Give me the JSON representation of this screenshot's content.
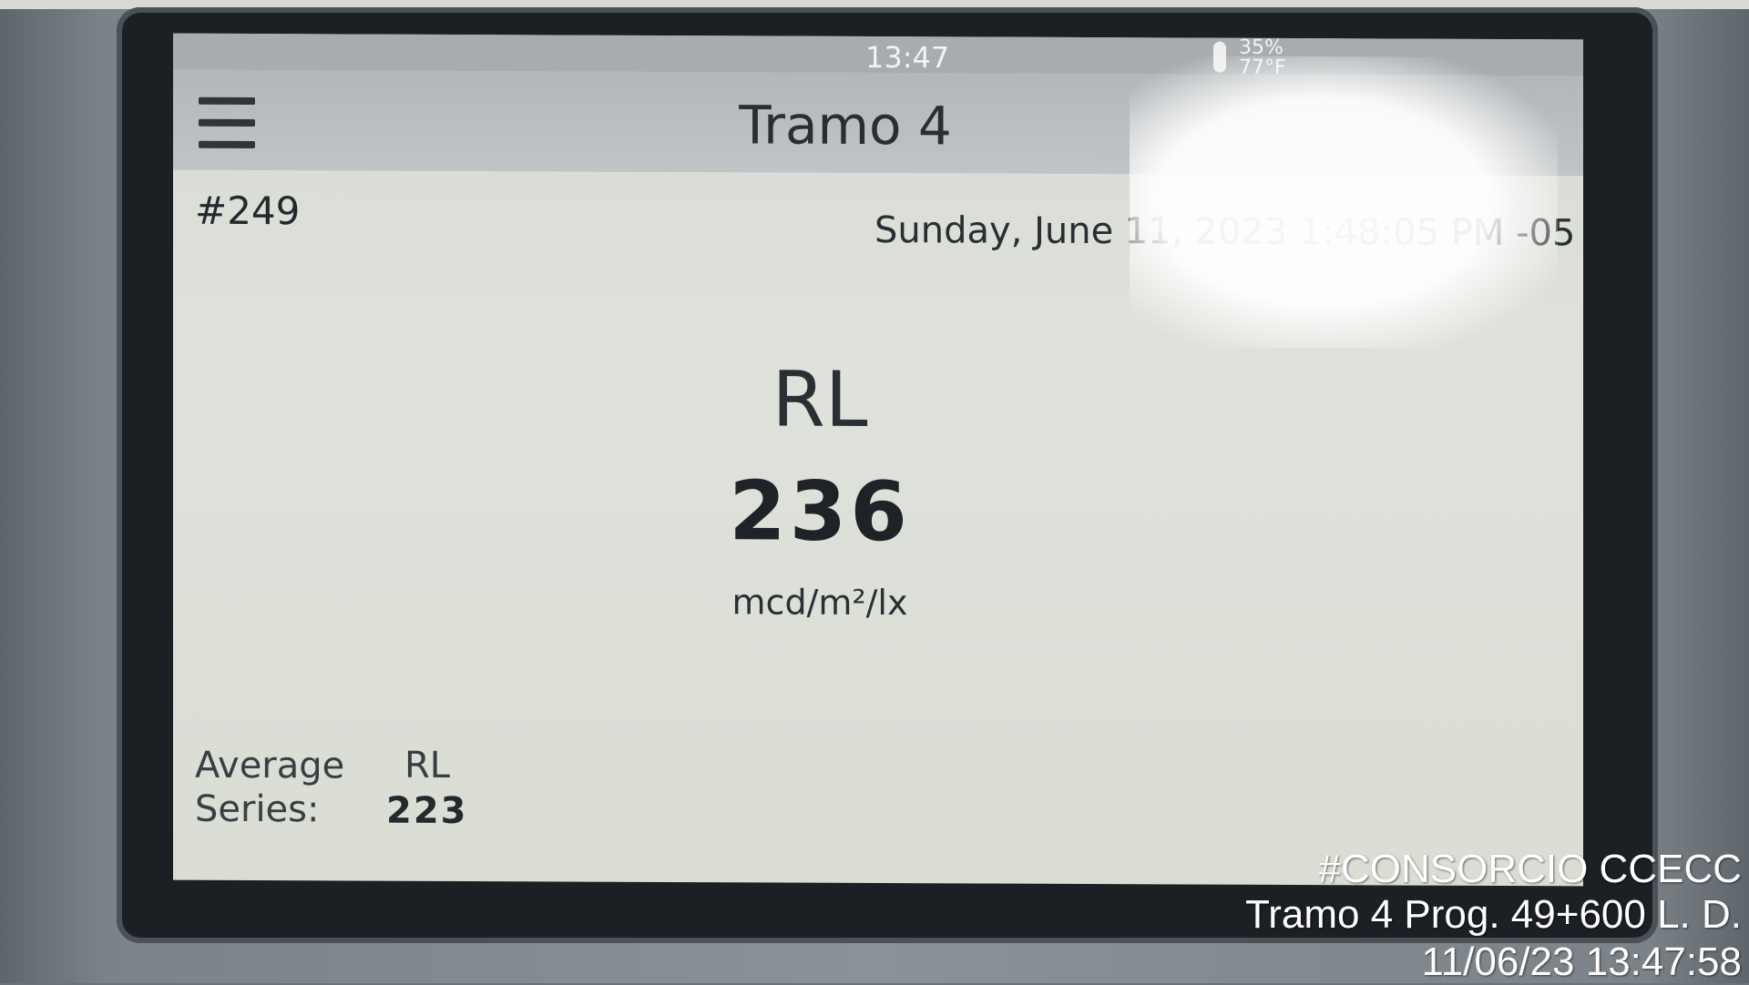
{
  "status_bar": {
    "time": "13:47",
    "humidity": "35%",
    "temperature": "77°F"
  },
  "header": {
    "title": "Tramo 4"
  },
  "record": {
    "number": "#249",
    "datetime": "Sunday, June 11, 2023 1:48:05 PM -05"
  },
  "measurement": {
    "label": "RL",
    "value": "236",
    "unit": "mcd/m²/lx"
  },
  "average": {
    "label_line1": "Average",
    "label_line2": "Series:",
    "metric": "RL",
    "value": "223"
  },
  "photo_overlay": {
    "line1": "#CONSORCIO CCECC",
    "line2": "Tramo 4 Prog. 49+600 L. D.",
    "line3": "11/06/23  13:47:58"
  }
}
